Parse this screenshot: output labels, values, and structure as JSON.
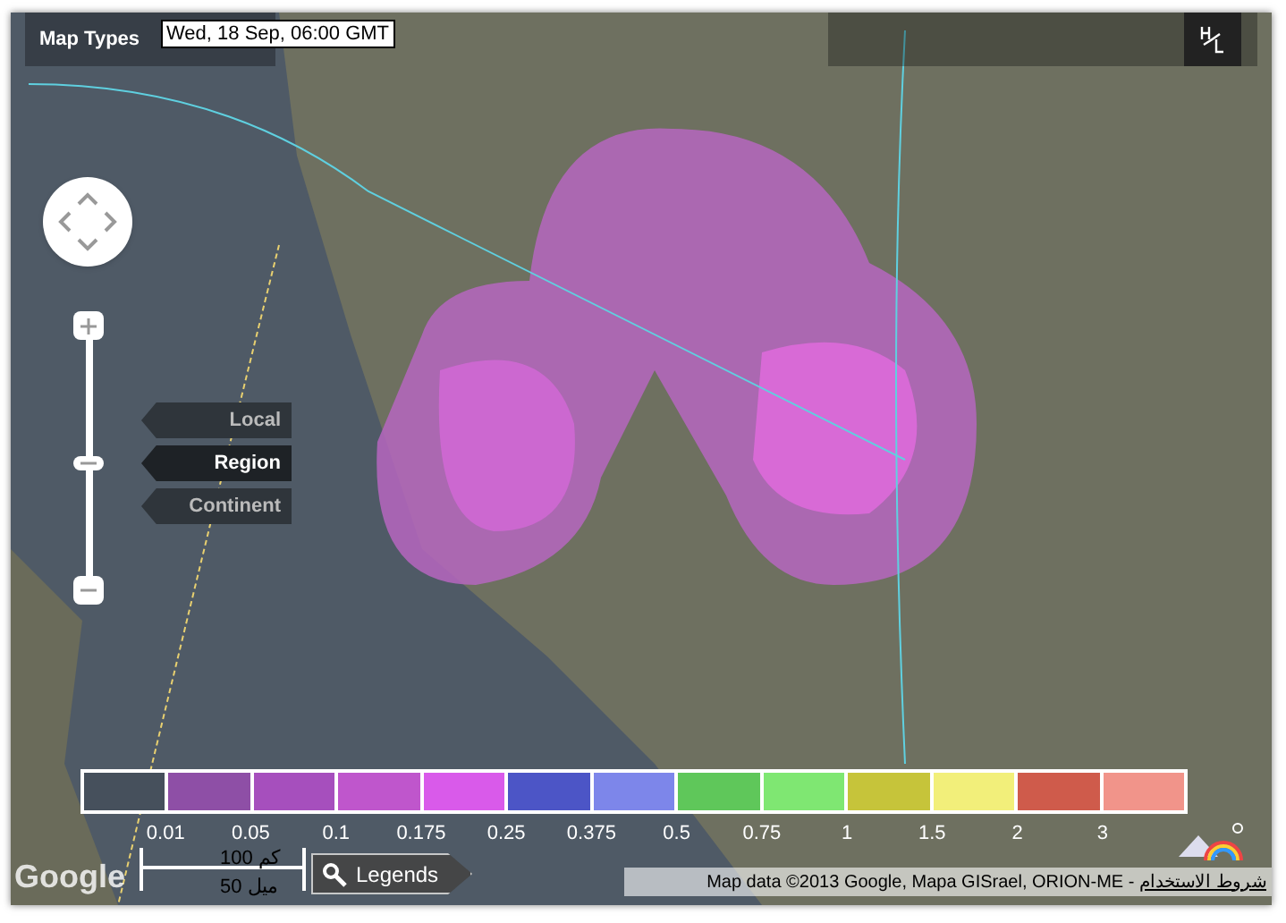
{
  "toolbar": {
    "map_types": "Map Types",
    "date": "Wed, 18 Sep, 06:00 GMT"
  },
  "zoom_levels": [
    {
      "label": "Local",
      "selected": false
    },
    {
      "label": "Region",
      "selected": true
    },
    {
      "label": "Continent",
      "selected": false
    }
  ],
  "legend": {
    "swatches": [
      {
        "color": "#46505c"
      },
      {
        "color": "#8e4fa6"
      },
      {
        "color": "#a64fbd"
      },
      {
        "color": "#bf56cc"
      },
      {
        "color": "#d95aea"
      },
      {
        "color": "#4c55c6"
      },
      {
        "color": "#7d86ea"
      },
      {
        "color": "#5fc75a"
      },
      {
        "color": "#7fe772"
      },
      {
        "color": "#c6c43a"
      },
      {
        "color": "#f2ef7a"
      },
      {
        "color": "#cf5b4b"
      },
      {
        "color": "#f1948a"
      }
    ],
    "values": [
      "0.01",
      "0.05",
      "0.1",
      "0.175",
      "0.25",
      "0.375",
      "0.5",
      "0.75",
      "1",
      "1.5",
      "2",
      "3"
    ]
  },
  "google_logo": "Google",
  "scale": {
    "km": "100 كم",
    "miles": "50 ميل"
  },
  "legends_button": "Legends",
  "attribution": {
    "text": "Map data ©2013 Google, Mapa GISrael, ORION-ME -",
    "terms": "شروط الاستخدام"
  }
}
